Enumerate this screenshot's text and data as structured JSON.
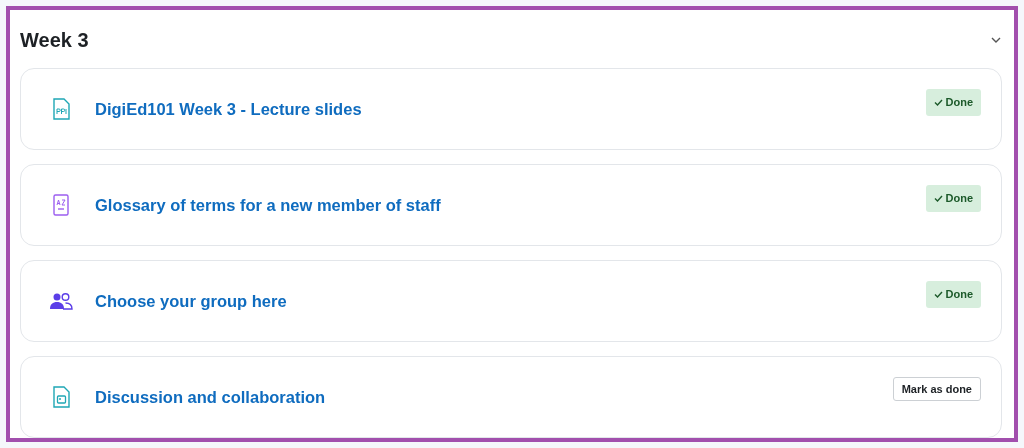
{
  "section": {
    "title": "Week 3",
    "expanded": true
  },
  "activities": [
    {
      "kind": "ppt",
      "title": "DigiEd101 Week 3 - Lecture slides",
      "done": true,
      "completion": "Done"
    },
    {
      "kind": "glossary",
      "title": "Glossary of terms for a new member of staff",
      "done": true,
      "completion": "Done"
    },
    {
      "kind": "group",
      "title": "Choose your group here",
      "done": true,
      "completion": "Done"
    },
    {
      "kind": "forum",
      "title": "Discussion and collaboration",
      "done": false,
      "completion": "Mark as done"
    }
  ]
}
